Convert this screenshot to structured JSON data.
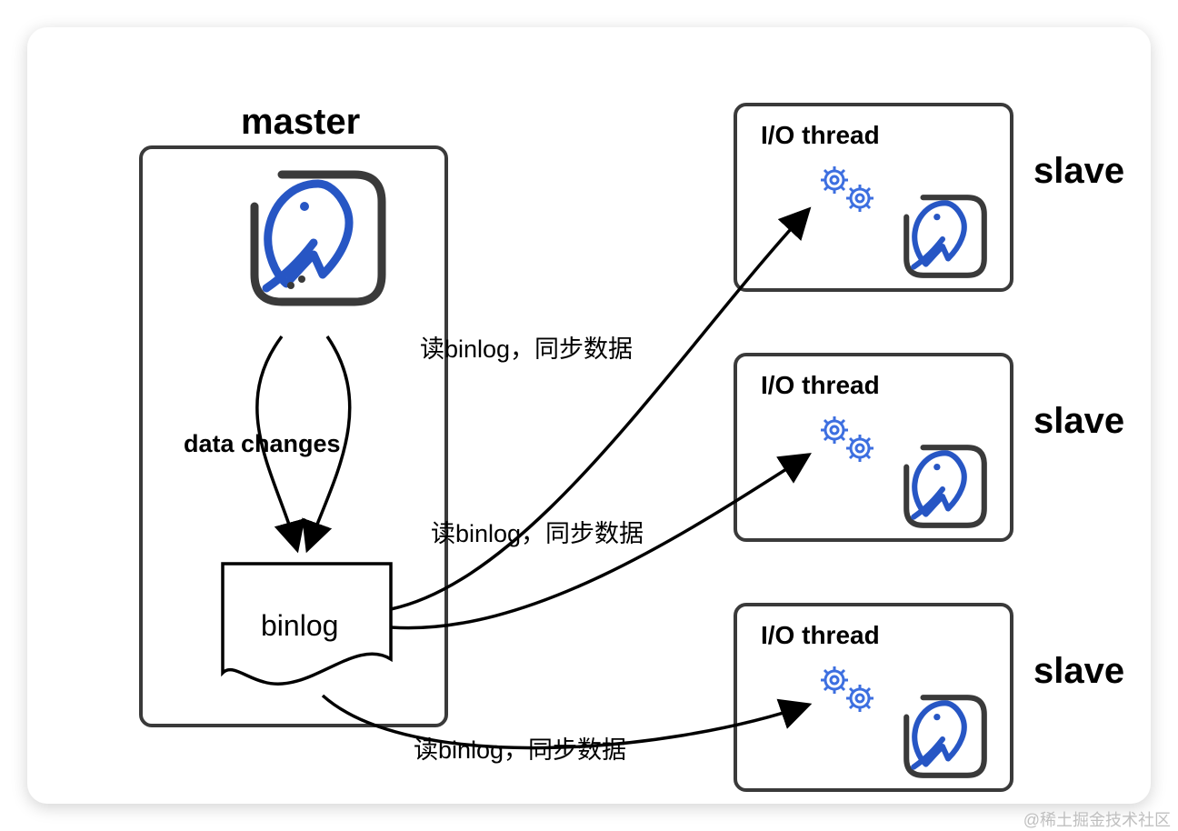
{
  "master": {
    "title": "master",
    "binlog": "binlog",
    "dataChanges": "data changes"
  },
  "syncLabel": "读binlog，同步数据",
  "slave": {
    "title": "slave",
    "ioThread": "I/O thread"
  },
  "watermark": "@稀土掘金技术社区"
}
